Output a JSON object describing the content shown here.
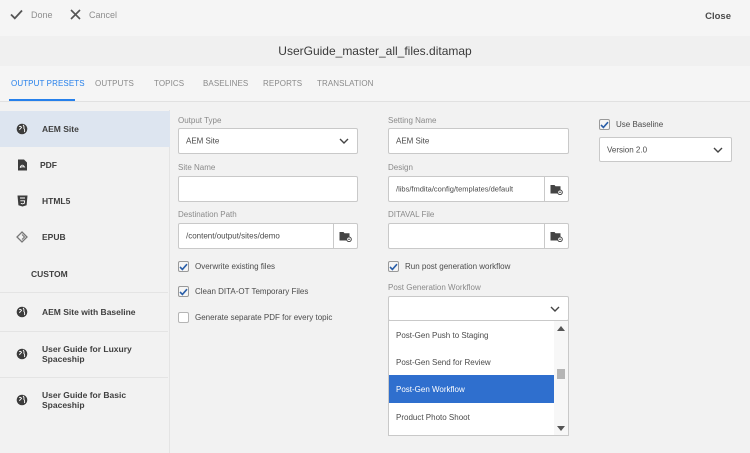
{
  "toolbar": {
    "done_label": "Done",
    "cancel_label": "Cancel",
    "close_label": "Close"
  },
  "title": "UserGuide_master_all_files.ditamap",
  "tabs": [
    {
      "label": "OUTPUT PRESETS",
      "active": true
    },
    {
      "label": "OUTPUTS"
    },
    {
      "label": "TOPICS"
    },
    {
      "label": "BASELINES"
    },
    {
      "label": "REPORTS"
    },
    {
      "label": "TRANSLATION"
    }
  ],
  "sidebar": {
    "items": [
      {
        "label": "AEM Site",
        "icon": "globe-icon",
        "selected": true
      },
      {
        "label": "PDF",
        "icon": "pdf-icon"
      },
      {
        "label": "HTML5",
        "icon": "html5-icon"
      },
      {
        "label": "EPUB",
        "icon": "epub-icon"
      },
      {
        "label": "CUSTOM",
        "icon": ""
      },
      {
        "label": "AEM Site with Baseline",
        "icon": "globe-icon"
      },
      {
        "label": "User Guide for Luxury Spaceship",
        "icon": "globe-icon"
      },
      {
        "label": "User Guide for Basic Spaceship",
        "icon": "globe-icon"
      }
    ]
  },
  "form": {
    "output_type": {
      "label": "Output Type",
      "value": "AEM Site"
    },
    "site_name": {
      "label": "Site Name",
      "value": ""
    },
    "destination_path": {
      "label": "Destination Path",
      "value": "/content/output/sites/demo"
    },
    "overwrite": {
      "label": "Overwrite existing files",
      "checked": true
    },
    "clean_temp": {
      "label": "Clean DITA-OT Temporary Files",
      "checked": true
    },
    "separate_pdf": {
      "label": "Generate separate PDF for every topic",
      "checked": false
    },
    "setting_name": {
      "label": "Setting Name",
      "value": "AEM Site"
    },
    "design": {
      "label": "Design",
      "value": "/libs/fmdita/config/templates/default"
    },
    "ditaval": {
      "label": "DITAVAL File",
      "value": ""
    },
    "run_post": {
      "label": "Run post generation workflow",
      "checked": true
    },
    "post_workflow": {
      "label": "Post Generation Workflow",
      "value": "",
      "options": [
        "Post-Gen Push to Staging",
        "Post-Gen Send for Review",
        "Post-Gen Workflow",
        "Product Photo Shoot"
      ],
      "selected_index": 2
    },
    "use_baseline": {
      "label": "Use Baseline",
      "checked": true
    },
    "baseline_version": {
      "value": "Version 2.0"
    }
  },
  "colors": {
    "accent": "#2680eb",
    "selection": "#2f6fce",
    "sidebar_selected": "#dde5f0"
  }
}
